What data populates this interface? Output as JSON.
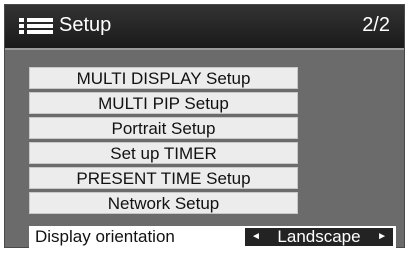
{
  "header": {
    "title": "Setup",
    "page_indicator": "2/2",
    "icon": "menu-list-icon"
  },
  "menu": {
    "items": [
      {
        "label": "MULTI DISPLAY Setup"
      },
      {
        "label": "MULTI PIP Setup"
      },
      {
        "label": "Portrait Setup"
      },
      {
        "label": "Set up TIMER"
      },
      {
        "label": "PRESENT TIME Setup"
      },
      {
        "label": "Network Setup"
      }
    ]
  },
  "orientation": {
    "label": "Display orientation",
    "value": "Landscape",
    "left_arrow": "◄",
    "right_arrow": "►"
  },
  "colors": {
    "panel": "#6b6b6b",
    "header": "#1a1a1a",
    "item_bg": "#ececec",
    "selector_bg": "#232323"
  }
}
